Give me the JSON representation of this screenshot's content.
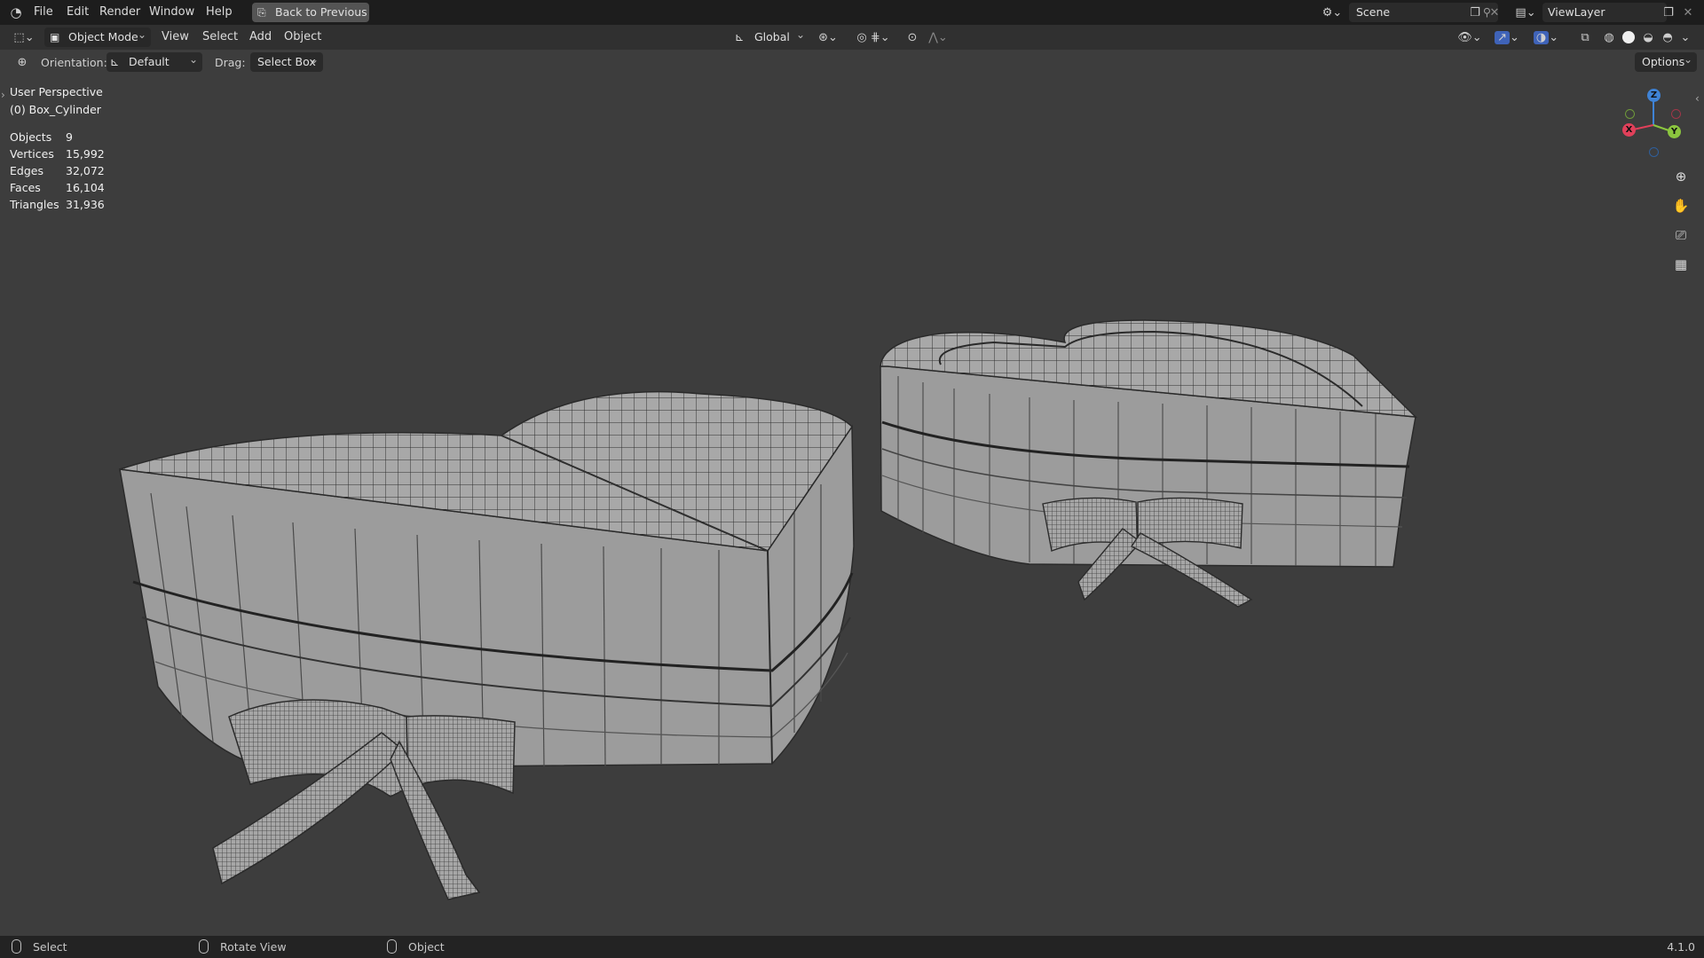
{
  "menubar": {
    "items": [
      "File",
      "Edit",
      "Render",
      "Window",
      "Help"
    ],
    "back_button": "Back to Previous",
    "scene_label": "Scene",
    "viewlayer_label": "ViewLayer"
  },
  "toolbar": {
    "mode": "Object Mode",
    "menus": [
      "View",
      "Select",
      "Add",
      "Object"
    ],
    "transform_orientation": "Global"
  },
  "header": {
    "orientation_label": "Orientation:",
    "orientation_value": "Default",
    "drag_label": "Drag:",
    "drag_value": "Select Box",
    "options_label": "Options"
  },
  "overlay": {
    "view_name": "User Perspective",
    "active_object": "(0) Box_Cylinder",
    "stats": [
      {
        "label": "Objects",
        "value": "9"
      },
      {
        "label": "Vertices",
        "value": "15,992"
      },
      {
        "label": "Edges",
        "value": "32,072"
      },
      {
        "label": "Faces",
        "value": "16,104"
      },
      {
        "label": "Triangles",
        "value": "31,936"
      }
    ]
  },
  "gizmo": {
    "x": "X",
    "y": "Y",
    "z": "Z"
  },
  "statusbar": {
    "select": "Select",
    "rotate": "Rotate View",
    "object": "Object",
    "version": "4.1.0"
  },
  "colors": {
    "background": "#3d3d3d",
    "topbar": "#1d1d1d",
    "toolbar": "#303030",
    "x_axis": "#e0405a",
    "y_axis": "#8bc53f",
    "z_axis": "#3f83d6"
  }
}
